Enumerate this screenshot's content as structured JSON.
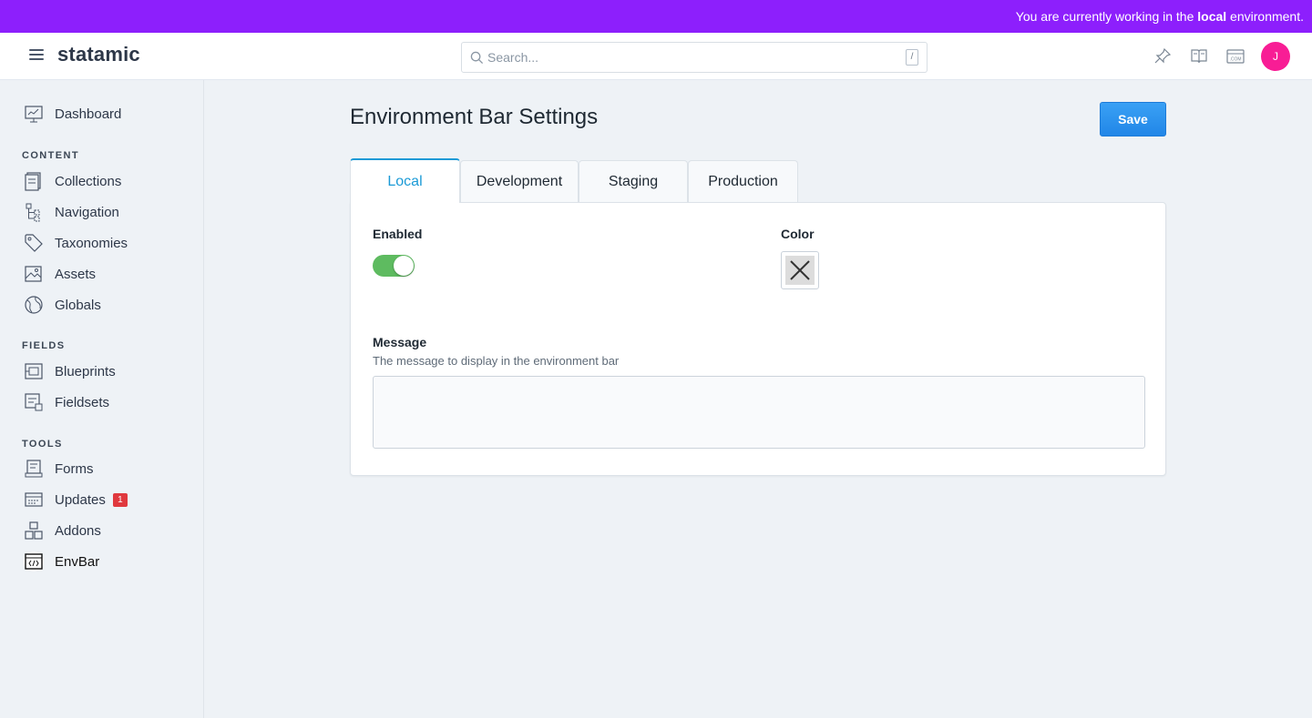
{
  "env_bar": {
    "prefix": "You are currently working in the ",
    "env": "local",
    "suffix": " environment."
  },
  "topbar": {
    "brand": "statamic",
    "search_placeholder": "Search...",
    "search_shortcut": "/",
    "avatar_initial": "J"
  },
  "sidebar": {
    "dashboard": "Dashboard",
    "content_heading": "CONTENT",
    "content_items": [
      "Collections",
      "Navigation",
      "Taxonomies",
      "Assets",
      "Globals"
    ],
    "fields_heading": "FIELDS",
    "fields_items": [
      "Blueprints",
      "Fieldsets"
    ],
    "tools_heading": "TOOLS",
    "tools_items": [
      "Forms",
      "Updates",
      "Addons",
      "EnvBar"
    ],
    "updates_badge": "1"
  },
  "main": {
    "title": "Environment Bar Settings",
    "save_label": "Save",
    "tabs": [
      "Local",
      "Development",
      "Staging",
      "Production"
    ],
    "active_tab": "Local",
    "enabled_label": "Enabled",
    "enabled": true,
    "color_label": "Color",
    "message_label": "Message",
    "message_help": "The message to display in the environment bar",
    "message_value": ""
  },
  "colors": {
    "env_bar": "#8d1ffc",
    "accent": "#1b9ad6",
    "save": "#2186e7",
    "toggle_on": "#5ebb60",
    "avatar": "#f81d95",
    "badge": "#e0393e"
  }
}
